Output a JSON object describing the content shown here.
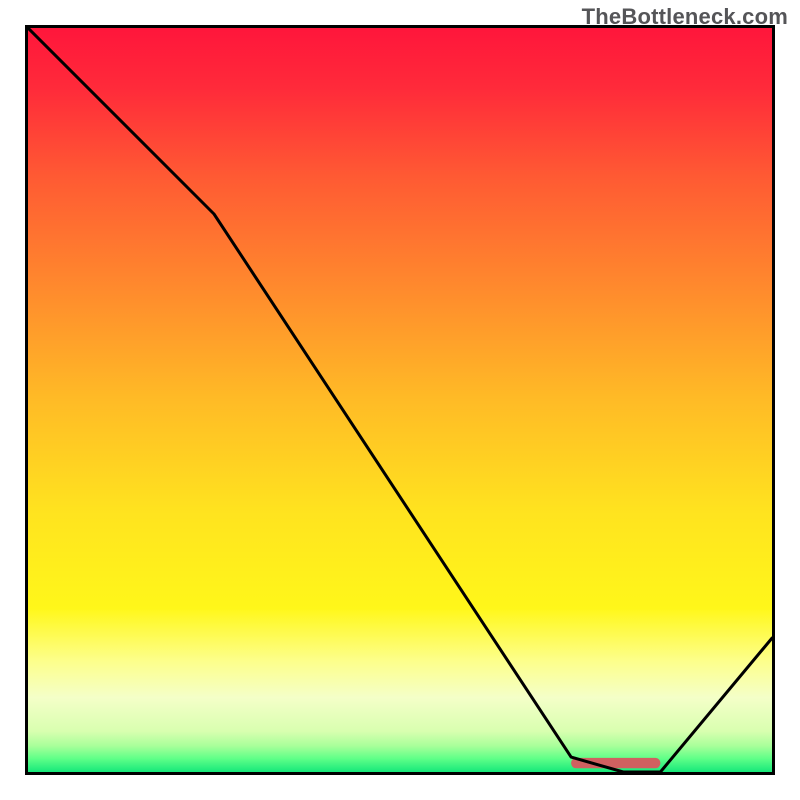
{
  "watermark": "TheBottleneck.com",
  "chart_data": {
    "type": "line",
    "title": "",
    "xlabel": "",
    "ylabel": "",
    "xlim": [
      0,
      100
    ],
    "ylim": [
      0,
      100
    ],
    "series": [
      {
        "name": "bottleneck-curve",
        "x": [
          0,
          25,
          73,
          80,
          85,
          100
        ],
        "values": [
          100,
          75,
          2,
          0,
          0,
          18
        ]
      }
    ],
    "optimal_range_x": [
      73,
      85
    ],
    "optimal_marker": {
      "color": "#d06060",
      "y_center": 1.2,
      "thickness_pct": 1.4
    },
    "gradient": [
      {
        "offset": 0.0,
        "color": "#ff163b"
      },
      {
        "offset": 0.08,
        "color": "#ff2a3a"
      },
      {
        "offset": 0.2,
        "color": "#ff5a33"
      },
      {
        "offset": 0.35,
        "color": "#ff8a2d"
      },
      {
        "offset": 0.5,
        "color": "#ffbb26"
      },
      {
        "offset": 0.65,
        "color": "#ffe31f"
      },
      {
        "offset": 0.78,
        "color": "#fff71a"
      },
      {
        "offset": 0.85,
        "color": "#fdff8a"
      },
      {
        "offset": 0.9,
        "color": "#f4ffc8"
      },
      {
        "offset": 0.945,
        "color": "#d9ffb0"
      },
      {
        "offset": 0.965,
        "color": "#a8ff9a"
      },
      {
        "offset": 0.982,
        "color": "#5fff88"
      },
      {
        "offset": 1.0,
        "color": "#16e87a"
      }
    ]
  }
}
